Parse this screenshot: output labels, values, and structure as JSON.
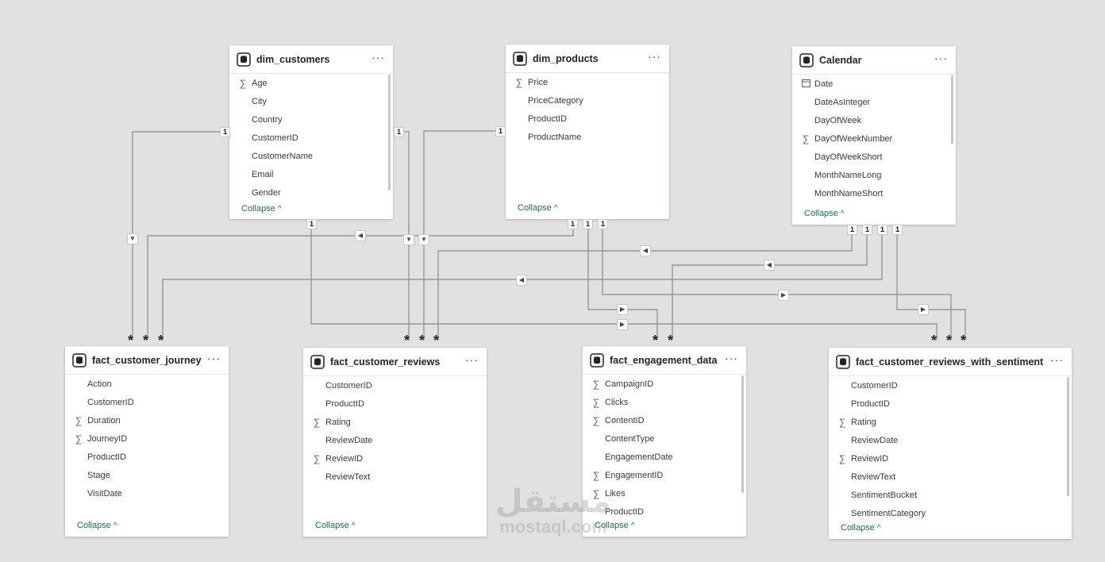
{
  "cards": {
    "dim_customers": {
      "title": "dim_customers",
      "more": "···",
      "fields": [
        {
          "name": "Age",
          "icon": "sigma"
        },
        {
          "name": "City",
          "icon": ""
        },
        {
          "name": "Country",
          "icon": ""
        },
        {
          "name": "CustomerID",
          "icon": ""
        },
        {
          "name": "CustomerName",
          "icon": ""
        },
        {
          "name": "Email",
          "icon": ""
        },
        {
          "name": "Gender",
          "icon": ""
        }
      ],
      "collapse_label": "Collapse"
    },
    "dim_products": {
      "title": "dim_products",
      "more": "···",
      "fields": [
        {
          "name": "Price",
          "icon": "sigma"
        },
        {
          "name": "PriceCategory",
          "icon": ""
        },
        {
          "name": "ProductID",
          "icon": ""
        },
        {
          "name": "ProductName",
          "icon": ""
        }
      ],
      "collapse_label": "Collapse"
    },
    "calendar": {
      "title": "Calendar",
      "more": "···",
      "fields": [
        {
          "name": "Date",
          "icon": "calendar"
        },
        {
          "name": "DateAsInteger",
          "icon": ""
        },
        {
          "name": "DayOfWeek",
          "icon": ""
        },
        {
          "name": "DayOfWeekNumber",
          "icon": "sigma"
        },
        {
          "name": "DayOfWeekShort",
          "icon": ""
        },
        {
          "name": "MonthNameLong",
          "icon": ""
        },
        {
          "name": "MonthNameShort",
          "icon": ""
        }
      ],
      "collapse_label": "Collapse"
    },
    "fact_customer_journey": {
      "title": "fact_customer_journey",
      "more": "···",
      "fields": [
        {
          "name": "Action",
          "icon": ""
        },
        {
          "name": "CustomerID",
          "icon": ""
        },
        {
          "name": "Duration",
          "icon": "sigma"
        },
        {
          "name": "JourneyID",
          "icon": "sigma"
        },
        {
          "name": "ProductID",
          "icon": ""
        },
        {
          "name": "Stage",
          "icon": ""
        },
        {
          "name": "VisitDate",
          "icon": ""
        }
      ],
      "collapse_label": "Collapse"
    },
    "fact_customer_reviews": {
      "title": "fact_customer_reviews",
      "more": "···",
      "fields": [
        {
          "name": "CustomerID",
          "icon": ""
        },
        {
          "name": "ProductID",
          "icon": ""
        },
        {
          "name": "Rating",
          "icon": "sigma"
        },
        {
          "name": "ReviewDate",
          "icon": ""
        },
        {
          "name": "ReviewID",
          "icon": "sigma"
        },
        {
          "name": "ReviewText",
          "icon": ""
        }
      ],
      "collapse_label": "Collapse"
    },
    "fact_engagement_data": {
      "title": "fact_engagement_data",
      "more": "···",
      "fields": [
        {
          "name": "CampaignID",
          "icon": "sigma"
        },
        {
          "name": "Clicks",
          "icon": "sigma"
        },
        {
          "name": "ContentID",
          "icon": "sigma"
        },
        {
          "name": "ContentType",
          "icon": ""
        },
        {
          "name": "EngagementDate",
          "icon": ""
        },
        {
          "name": "EngagementID",
          "icon": "sigma"
        },
        {
          "name": "Likes",
          "icon": "sigma"
        },
        {
          "name": "ProductID",
          "icon": ""
        }
      ],
      "collapse_label": "Collapse"
    },
    "fact_customer_reviews_with_sentiment": {
      "title": "fact_customer_reviews_with_sentiment",
      "more": "···",
      "fields": [
        {
          "name": "CustomerID",
          "icon": ""
        },
        {
          "name": "ProductID",
          "icon": ""
        },
        {
          "name": "Rating",
          "icon": "sigma"
        },
        {
          "name": "ReviewDate",
          "icon": ""
        },
        {
          "name": "ReviewID",
          "icon": "sigma"
        },
        {
          "name": "ReviewText",
          "icon": ""
        },
        {
          "name": "SentimentBucket",
          "icon": ""
        },
        {
          "name": "SentimentCategory",
          "icon": ""
        }
      ],
      "collapse_label": "Collapse"
    }
  },
  "relationships": {
    "one": "1",
    "many": "*"
  },
  "watermark": {
    "arabic": "مستقل",
    "latin": "mostaql.com"
  }
}
